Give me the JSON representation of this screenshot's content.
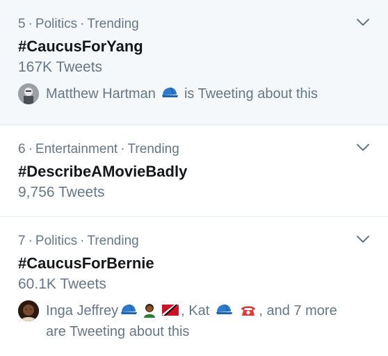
{
  "trends": [
    {
      "rank": "5",
      "category": "Politics",
      "status": "Trending",
      "title": "#CaucusForYang",
      "count": "167K Tweets",
      "social": {
        "name": "Matthew Hartman",
        "suffix": "is Tweeting about this",
        "emoji": [
          "blue-cap-emoji"
        ]
      }
    },
    {
      "rank": "6",
      "category": "Entertainment",
      "status": "Trending",
      "title": "#DescribeAMovieBadly",
      "count": "9,756 Tweets"
    },
    {
      "rank": "7",
      "category": "Politics",
      "status": "Trending",
      "title": "#CaucusForBernie",
      "count": "60.1K Tweets",
      "social": {
        "name1": "Inga Jeffrey",
        "sep1": ",",
        "name2": "Kat",
        "tail": ", and 7 more",
        "suffix": "are Tweeting about this",
        "emoji": [
          "blue-cap-emoji",
          "woman-emoji",
          "trinidad-flag-emoji",
          "blue-cap-emoji",
          "telephone-emoji"
        ]
      }
    }
  ],
  "separator": "·",
  "colors": {
    "secondary_text": "#657786",
    "primary_text": "#14171a",
    "hover_bg": "#f5f8fa",
    "divider": "#e6ecf0"
  }
}
